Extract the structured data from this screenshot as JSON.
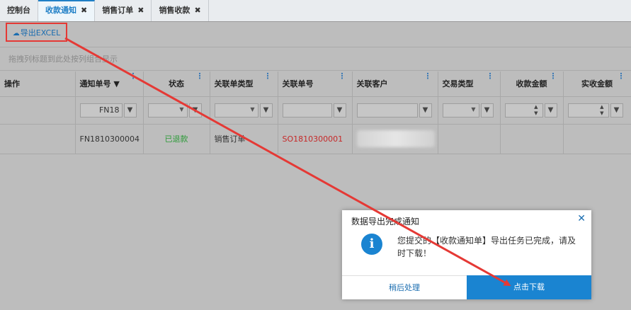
{
  "tabs": [
    {
      "label": "控制台",
      "closable": false,
      "active": false
    },
    {
      "label": "收款通知",
      "closable": true,
      "active": true
    },
    {
      "label": "销售订单",
      "closable": true,
      "active": false
    },
    {
      "label": "销售收款",
      "closable": true,
      "active": false
    }
  ],
  "toolbar": {
    "export_label": "导出EXCEL",
    "export_icon": "cloud-download-icon"
  },
  "group_hint": "拖拽列标题到此处按列组合显示",
  "grid": {
    "columns": [
      "操作",
      "通知单号 ▼",
      "状态",
      "关联单类型",
      "关联单号",
      "关联客户",
      "交易类型",
      "收款金额",
      "实收金额"
    ],
    "filter_notice_no": "FN18",
    "rows": [
      {
        "action": "",
        "notice_no": "FN1810300004",
        "status": "已退款",
        "link_type": "销售订单",
        "link_no": "SO1810300001",
        "customer": "",
        "trade_type": "",
        "amount": "",
        "received": ""
      }
    ]
  },
  "dialog": {
    "title": "数据导出完成通知",
    "message": "您提交的【收款通知单】导出任务已完成，请及时下载！",
    "later_label": "稍后处理",
    "download_label": "点击下载",
    "close_glyph": "✕",
    "info_glyph": "i"
  },
  "colors": {
    "accent": "#1a84d1",
    "annotation": "#e53935",
    "status_ok": "#2e9b3a",
    "link_no": "#c62828"
  }
}
